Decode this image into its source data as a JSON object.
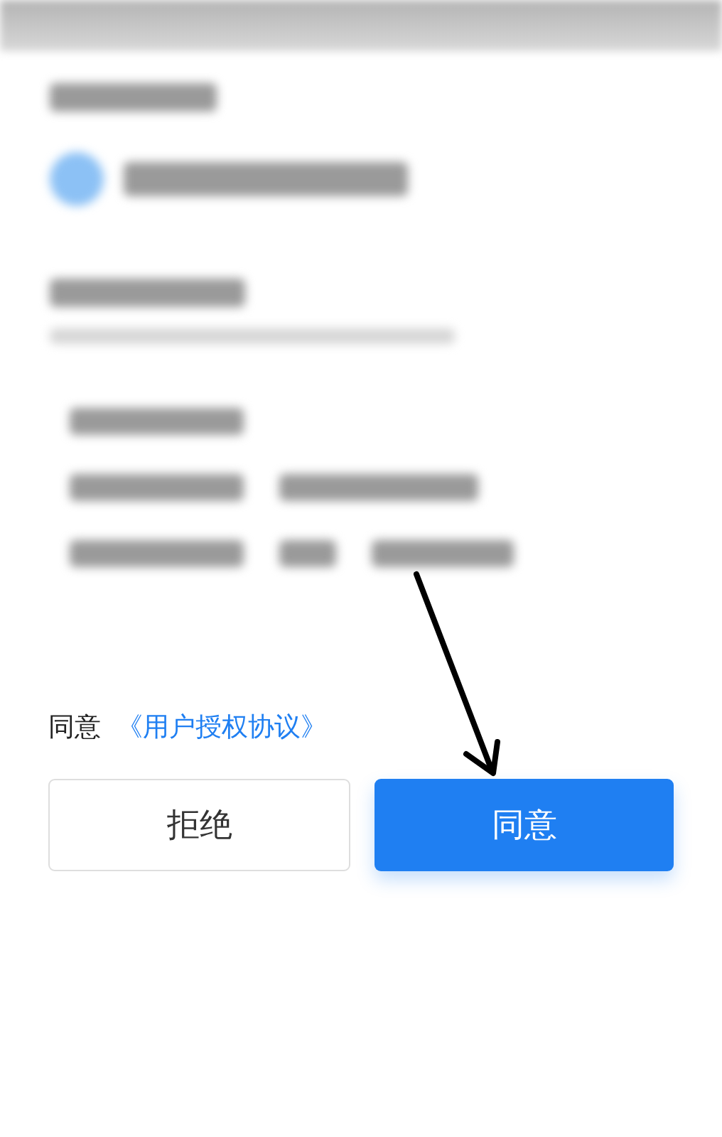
{
  "consent": {
    "prefix": "同意",
    "link": "《用户授权协议》"
  },
  "buttons": [
    {
      "label": "拒绝",
      "kind": "secondary"
    },
    {
      "label": "同意",
      "kind": "primary"
    }
  ]
}
